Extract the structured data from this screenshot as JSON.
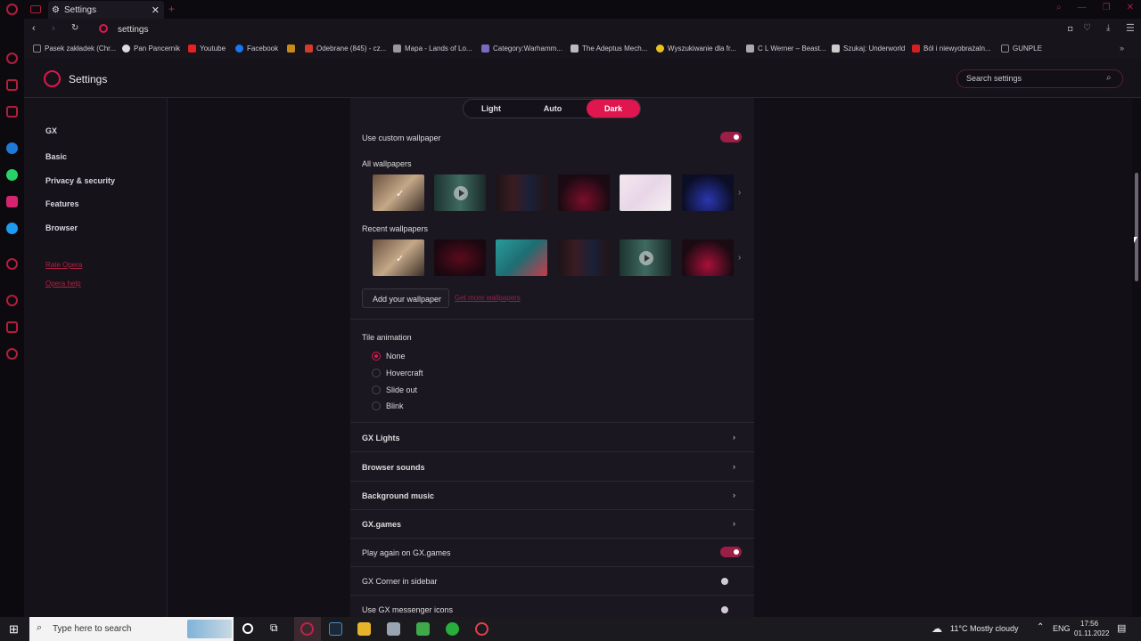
{
  "tab": {
    "title": "Settings"
  },
  "address": {
    "url": "settings"
  },
  "bookmarks": [
    {
      "label": "Pasek zakładek (Chr...",
      "color": "#888888"
    },
    {
      "label": "Pan Pancernik",
      "color": "#dddddd"
    },
    {
      "label": "Youtube",
      "color": "#e52222"
    },
    {
      "label": "Facebook",
      "color": "#1877f2"
    },
    {
      "label": "",
      "color": "#c98a1a"
    },
    {
      "label": "Odebrane (845) - cz...",
      "color": "#d33b2c"
    },
    {
      "label": "Mapa - Lands of Lo...",
      "color": "#999999"
    },
    {
      "label": "Category:Warhamm...",
      "color": "#7a6ac0"
    },
    {
      "label": "The Adeptus Mech...",
      "color": "#bbbbbb"
    },
    {
      "label": "Wyszukiwanie dla fr...",
      "color": "#e6c21a"
    },
    {
      "label": "C L Werner – Beast...",
      "color": "#aaaaaa"
    },
    {
      "label": "Szukaj: Underworld",
      "color": "#cccccc"
    },
    {
      "label": "Ból i niewyobrażaln...",
      "color": "#d32020"
    },
    {
      "label": "GUNPLE",
      "color": "#888888"
    }
  ],
  "header": {
    "title": "Settings",
    "search_placeholder": "Search settings"
  },
  "nav": {
    "items": [
      "GX",
      "Basic",
      "Privacy & security",
      "Features",
      "Browser"
    ],
    "links": [
      "Rate Opera",
      "Opera help"
    ]
  },
  "theme": {
    "options": [
      "Light",
      "Auto",
      "Dark"
    ],
    "selected": "Dark"
  },
  "wallpaper": {
    "custom_label": "Use custom wallpaper",
    "custom_on": true,
    "all_label": "All wallpapers",
    "recent_label": "Recent wallpapers",
    "add_label": "Add your wallpaper",
    "more_label": "Get more wallpapers"
  },
  "tile_animation": {
    "label": "Tile animation",
    "options": [
      "None",
      "Hovercraft",
      "Slide out",
      "Blink"
    ],
    "selected": "None"
  },
  "sections": [
    {
      "label": "GX Lights"
    },
    {
      "label": "Browser sounds"
    },
    {
      "label": "Background music"
    },
    {
      "label": "GX.games"
    }
  ],
  "toggles": [
    {
      "label": "Play again on GX.games",
      "on": true
    },
    {
      "label": "GX Corner in sidebar",
      "on": false
    },
    {
      "label": "Use GX messenger icons",
      "on": false
    }
  ],
  "taskbar": {
    "search_placeholder": "Type here to search",
    "weather": "11°C  Mostly cloudy",
    "lang": "ENG",
    "time": "17:56",
    "date": "01.11.2022"
  },
  "colors": {
    "accent": "#e0164f",
    "panel": "#1a1720",
    "background": "#120f16"
  }
}
